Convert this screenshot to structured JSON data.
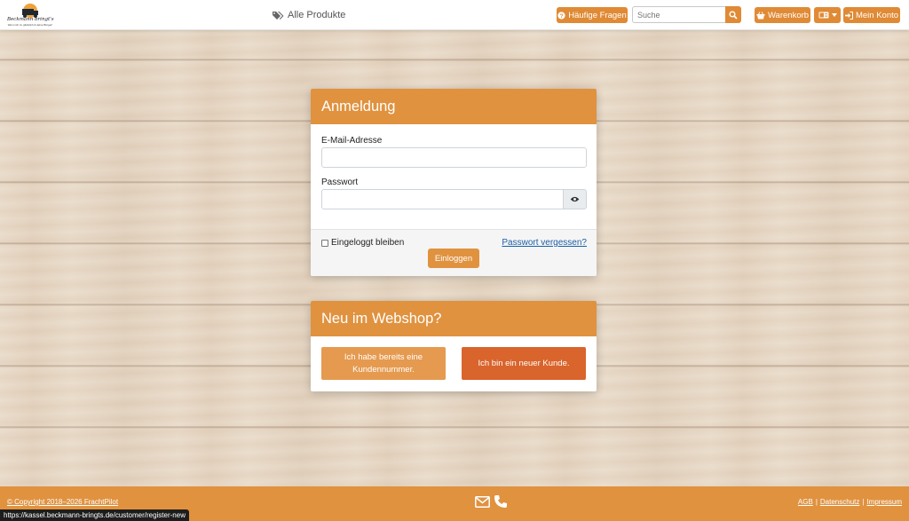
{
  "header": {
    "logo_text": "Beckmann bringt's",
    "logo_tagline": "Wenn ich zu glücklich & deine Bürger!",
    "products_link": "Alle Produkte",
    "faq_label": "Häufige Fragen",
    "search": {
      "placeholder": "Suche",
      "value": "Suche"
    },
    "cart_label": "Warenkorb",
    "account_label": "Mein Konto"
  },
  "login": {
    "title": "Anmeldung",
    "email_label": "E-Mail-Adresse",
    "email_value": "",
    "password_label": "Passwort",
    "password_value": "",
    "remember_label": "Eingeloggt bleiben",
    "forgot_label": "Passwort vergessen?",
    "submit_label": "Einloggen"
  },
  "register": {
    "title": "Neu im Webshop?",
    "existing_customer_label": "Ich habe bereits eine Kundennummer.",
    "new_customer_label": "Ich bin ein neuer Kunde."
  },
  "footer": {
    "copyright": "© Copyright 2018–2026 FrachtPilot",
    "links": [
      "AGB",
      "Datenschutz",
      "Impressum"
    ],
    "separator": "|"
  },
  "status_bar_url": "https://kassel.beckmann-bringts.de/customer/register-new",
  "colors": {
    "accent": "#e0923f",
    "accent_dark": "#d9642c",
    "link": "#1b5fa6"
  }
}
